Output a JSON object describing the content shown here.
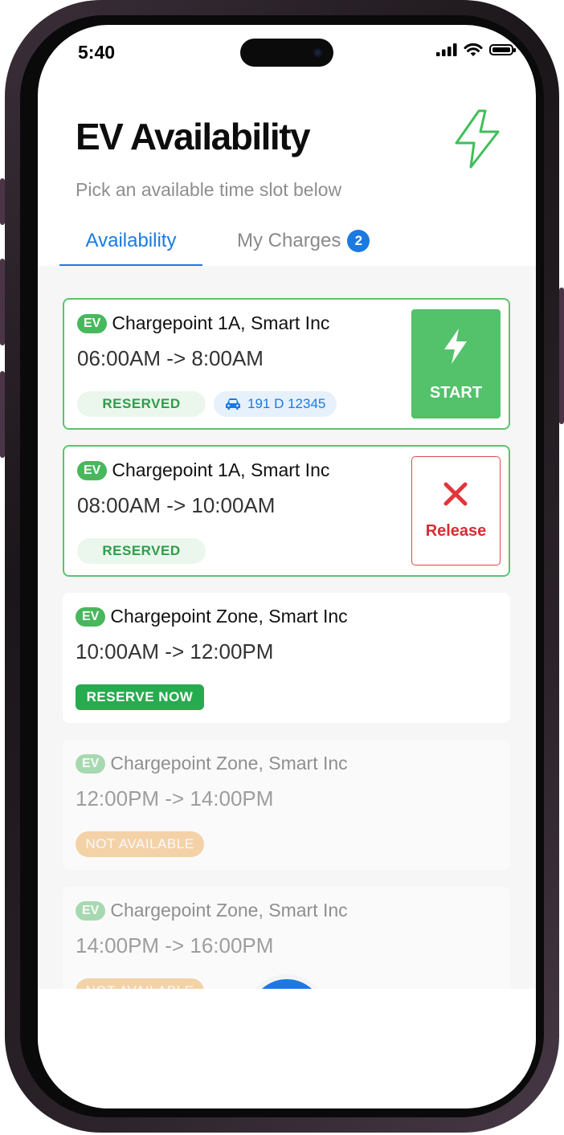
{
  "status_bar": {
    "time": "5:40"
  },
  "header": {
    "title": "EV Availability",
    "subtitle": "Pick an available time slot below",
    "logo_icon": "lightning-bolt-icon"
  },
  "tabs": [
    {
      "label": "Availability",
      "active": true
    },
    {
      "label": "My Charges",
      "badge": "2",
      "active": false
    }
  ],
  "slots": [
    {
      "tag": "EV",
      "location": "Chargepoint 1A, Smart Inc",
      "time": "06:00AM -> 8:00AM",
      "status": "RESERVED",
      "plate": "191 D 12345",
      "action": "START"
    },
    {
      "tag": "EV",
      "location": "Chargepoint 1A, Smart Inc",
      "time": "08:00AM -> 10:00AM",
      "status": "RESERVED",
      "action": "Release"
    },
    {
      "tag": "EV",
      "location": "Chargepoint Zone, Smart Inc",
      "time": "10:00AM -> 12:00PM",
      "status": "RESERVE NOW"
    },
    {
      "tag": "EV",
      "location": "Chargepoint Zone, Smart Inc",
      "time": "12:00PM -> 14:00PM",
      "status": "NOT AVAILABLE"
    },
    {
      "tag": "EV",
      "location": "Chargepoint Zone, Smart Inc",
      "time": "14:00PM -> 16:00PM",
      "status": "NOT AVAILABLE"
    }
  ],
  "colors": {
    "accent": "#1a7ae0",
    "green": "#53c26a",
    "red": "#d62e33",
    "orange": "#f2a74b"
  }
}
